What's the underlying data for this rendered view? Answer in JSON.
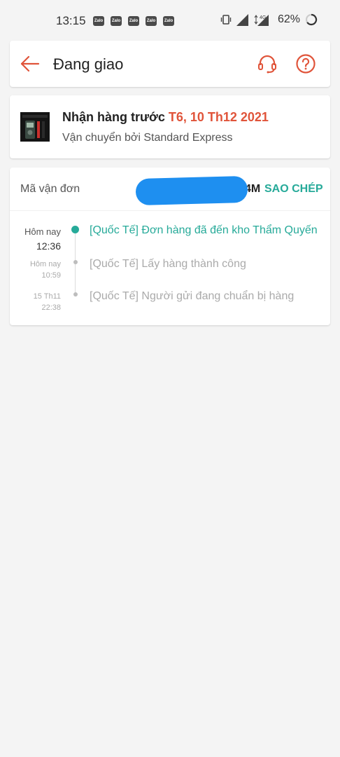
{
  "status_bar": {
    "time": "13:15",
    "apps": [
      "Zalo",
      "Zalo",
      "Zalo",
      "Zalo",
      "Zalo"
    ],
    "network": "4G",
    "battery": "62%"
  },
  "header": {
    "title": "Đang giao"
  },
  "delivery": {
    "prefix": "Nhận hàng trước ",
    "date": "T6, 10 Th12 2021",
    "carrier": "Vận chuyển bởi Standard Express"
  },
  "tracking": {
    "code_label": "Mã vận đơn",
    "code_suffix": "4M",
    "copy_label": "SAO CHÉP",
    "events": [
      {
        "day": "Hôm nay",
        "time": "12:36",
        "text": "[Quốc Tế] Đơn hàng đã đến kho Thẩm Quyến"
      },
      {
        "day": "Hôm nay",
        "time": "10:59",
        "text": "[Quốc Tế] Lấy hàng thành công"
      },
      {
        "day": "15 Th11",
        "time": "22:38",
        "text": "[Quốc Tế] Người gửi đang chuẩn bị hàng"
      }
    ]
  },
  "colors": {
    "accent": "#e0543a",
    "teal": "#26aa99",
    "redaction": "#1e8ff0"
  }
}
